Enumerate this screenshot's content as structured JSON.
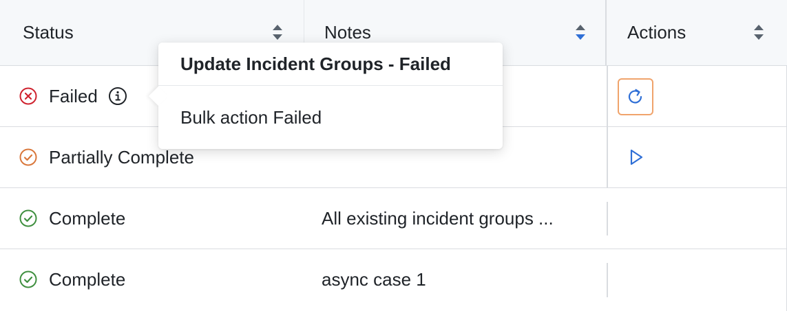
{
  "table": {
    "columns": [
      {
        "label": "Status",
        "sort": "none"
      },
      {
        "label": "Notes",
        "sort": "ascending"
      },
      {
        "label": "Actions",
        "sort": "none"
      }
    ],
    "rows": [
      {
        "status": "Failed",
        "status_icon": "x-circle-icon",
        "status_color": "#cf222e",
        "notes": "",
        "action": "retry-icon"
      },
      {
        "status": "Partially Complete",
        "status_icon": "check-circle-icon",
        "status_color": "#d9773b",
        "notes": "",
        "action": "play-icon"
      },
      {
        "status": "Complete",
        "status_icon": "check-circle-icon",
        "status_color": "#3f8f3f",
        "notes": "All existing incident groups ...",
        "action": ""
      },
      {
        "status": "Complete",
        "status_icon": "check-circle-icon",
        "status_color": "#3f8f3f",
        "notes": "async case 1",
        "action": ""
      }
    ]
  },
  "popover": {
    "title": "Update Incident Groups - Failed",
    "body": "Bulk action Failed"
  },
  "colors": {
    "accent": "#2f6fd6",
    "focus_ring": "#f0a36b",
    "header_bg": "#f6f8fa",
    "border": "#d9dce0"
  }
}
